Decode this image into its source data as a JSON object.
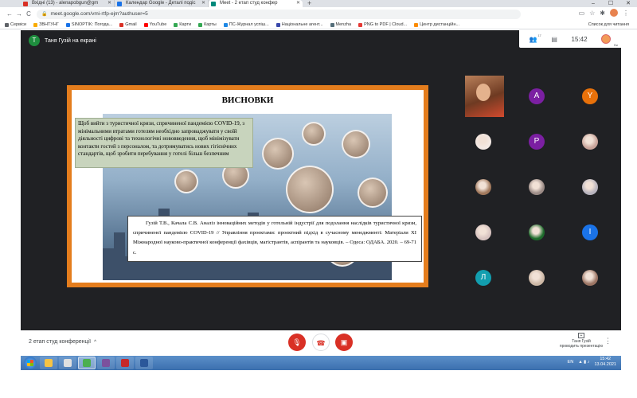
{
  "browser": {
    "tabs": [
      {
        "label": "Вхідні (13) - alenapobgun@gm",
        "favicon_color": "#d93025",
        "active": false
      },
      {
        "label": "Календар Google - Деталі подіс",
        "favicon_color": "#1a73e8",
        "active": false
      },
      {
        "label": "Meet - 2 етап студ конфер",
        "favicon_color": "#00897b",
        "active": true
      }
    ],
    "new_tab": "+",
    "window_controls": [
      "–",
      "☐",
      "✕"
    ],
    "url": "meet.google.com/vmi-rtfp-ejm?authuser=5",
    "nav": {
      "back": "←",
      "forward": "→",
      "reload": "C"
    },
    "bookmarks": [
      {
        "label": "Сервіси",
        "color": "#5f6368"
      },
      {
        "label": "ЗВНТУНГ",
        "color": "#f9ab00"
      },
      {
        "label": "SINOPTIK: Погода...",
        "color": "#1a73e8"
      },
      {
        "label": "Gmail",
        "color": "#d93025"
      },
      {
        "label": "YouTube",
        "color": "#ff0000"
      },
      {
        "label": "Карти",
        "color": "#34a853"
      },
      {
        "label": "Карты",
        "color": "#34a853"
      },
      {
        "label": "ПС-Журнал успіш...",
        "color": "#1e88e5"
      },
      {
        "label": "Національне агент...",
        "color": "#3949ab"
      },
      {
        "label": "Menzha",
        "color": "#546e7a"
      },
      {
        "label": "PNG to PDF | Cloud...",
        "color": "#e53935"
      },
      {
        "label": "Центр дистанційн...",
        "color": "#fb8c00"
      }
    ],
    "reading_list": "Список для читання"
  },
  "meet": {
    "presenter_initial": "T",
    "presenter_label": "Таня Гузій на екрані",
    "participants_count": "17",
    "clock": "15:42",
    "self_label": "Ви",
    "meeting_title": "2 етап студ конференції",
    "presenting_label_line1": "Таня Гузій",
    "presenting_label_line2": "проводить презентацію"
  },
  "slide": {
    "title": "ВИСНОВКИ",
    "summary": "Щоб вийти з туристичної кризи, спричиненої пандемією COVID-19, з мінімальними втратами готелям необхідно запроваджувати у своїй діяльності цифрові та технологічні нововведення, щоб мінімізувати контакти гостей з персоналом, та дотримуватись нових гігієнічних стандартів, щоб зробити перебування у готелі більш безпечним",
    "reference": "Гузій Т.В., Качала С.В. Аналіз інноваційних методів у готельній індустрії для подолання наслідків туристичної кризи, спричиненої пандемією COVID-19 // Управління проектами: проектний підхід в сучасному менеджменті: Матеріали XI Міжнародної науково-практичної конференції фахівців, магістрантів, аспірантів та науковців. – Одеса: ОДАБА. 2020. – 69-71 с."
  },
  "participants": [
    {
      "type": "video"
    },
    {
      "type": "letter",
      "letter": "A",
      "color": "#7b1fa2"
    },
    {
      "type": "letter",
      "letter": "Y",
      "color": "#e8710a"
    },
    {
      "type": "photo",
      "color": "#f3e9e4"
    },
    {
      "type": "letter",
      "letter": "P",
      "color": "#7b1fa2"
    },
    {
      "type": "photo",
      "color": "#c9a49a"
    },
    {
      "type": "photo",
      "color": "#a0785c"
    },
    {
      "type": "photo",
      "color": "#9b8b86"
    },
    {
      "type": "photo",
      "color": "#b7b3bd"
    },
    {
      "type": "photo",
      "color": "#d7c3c0"
    },
    {
      "type": "photo",
      "color": "#1d6b2b"
    },
    {
      "type": "letter",
      "letter": "I",
      "color": "#1a73e8"
    },
    {
      "type": "letter",
      "letter": "Л",
      "color": "#129eaf"
    },
    {
      "type": "photo",
      "color": "#cdb8a6"
    },
    {
      "type": "photo",
      "color": "#9c7564"
    }
  ],
  "controls": {
    "mic_icon": "mic-off-icon",
    "hangup_icon": "call-end-icon",
    "camera_icon": "videocam-off-icon",
    "danger_color": "#d93025"
  },
  "taskbar": {
    "apps": [
      {
        "name": "explorer",
        "color": "#f6c343"
      },
      {
        "name": "media",
        "color": "#e0e0e0"
      },
      {
        "name": "chrome",
        "color": "#4caf50"
      },
      {
        "name": "viber",
        "color": "#7b519d"
      },
      {
        "name": "pdf",
        "color": "#c62828"
      },
      {
        "name": "word",
        "color": "#2b579a"
      }
    ],
    "lang": "EN",
    "time": "15:42",
    "date": "13.04.2021"
  }
}
